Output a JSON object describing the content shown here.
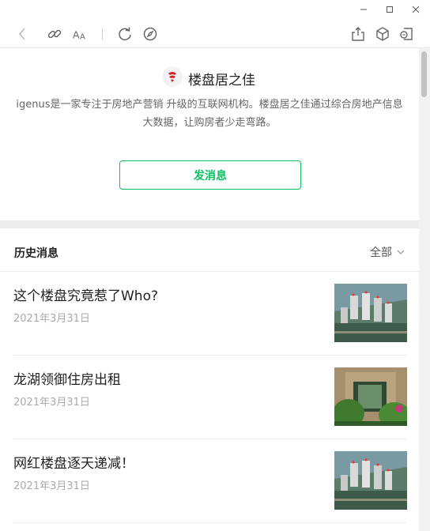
{
  "window": {
    "controls": [
      "minimize",
      "maximize",
      "close"
    ]
  },
  "toolbar": {
    "icons": [
      "back-icon",
      "link-icon",
      "font-size-icon",
      "refresh-icon",
      "compass-icon",
      "share-icon",
      "box-icon",
      "mini-program-icon"
    ]
  },
  "account": {
    "name": "楼盘居之佳",
    "description": "igenus是一家专注于房地产营销 升级的互联网机构。楼盘居之佳通过综合房地产信息大数据，让购房者少走弯路。",
    "send_label": "发消息",
    "accent_color": "#07c160"
  },
  "history": {
    "title": "历史消息",
    "filter_label": "全部",
    "items": [
      {
        "title": "这个楼盘究竟惹了Who?",
        "date": "2021年3月31日",
        "thumb": "aerial-buildings"
      },
      {
        "title": "龙湖领御住房出租",
        "date": "2021年3月31日",
        "thumb": "garden-entrance"
      },
      {
        "title": "网红楼盘逐天递减！",
        "date": "2021年3月31日",
        "thumb": "aerial-buildings"
      }
    ]
  }
}
